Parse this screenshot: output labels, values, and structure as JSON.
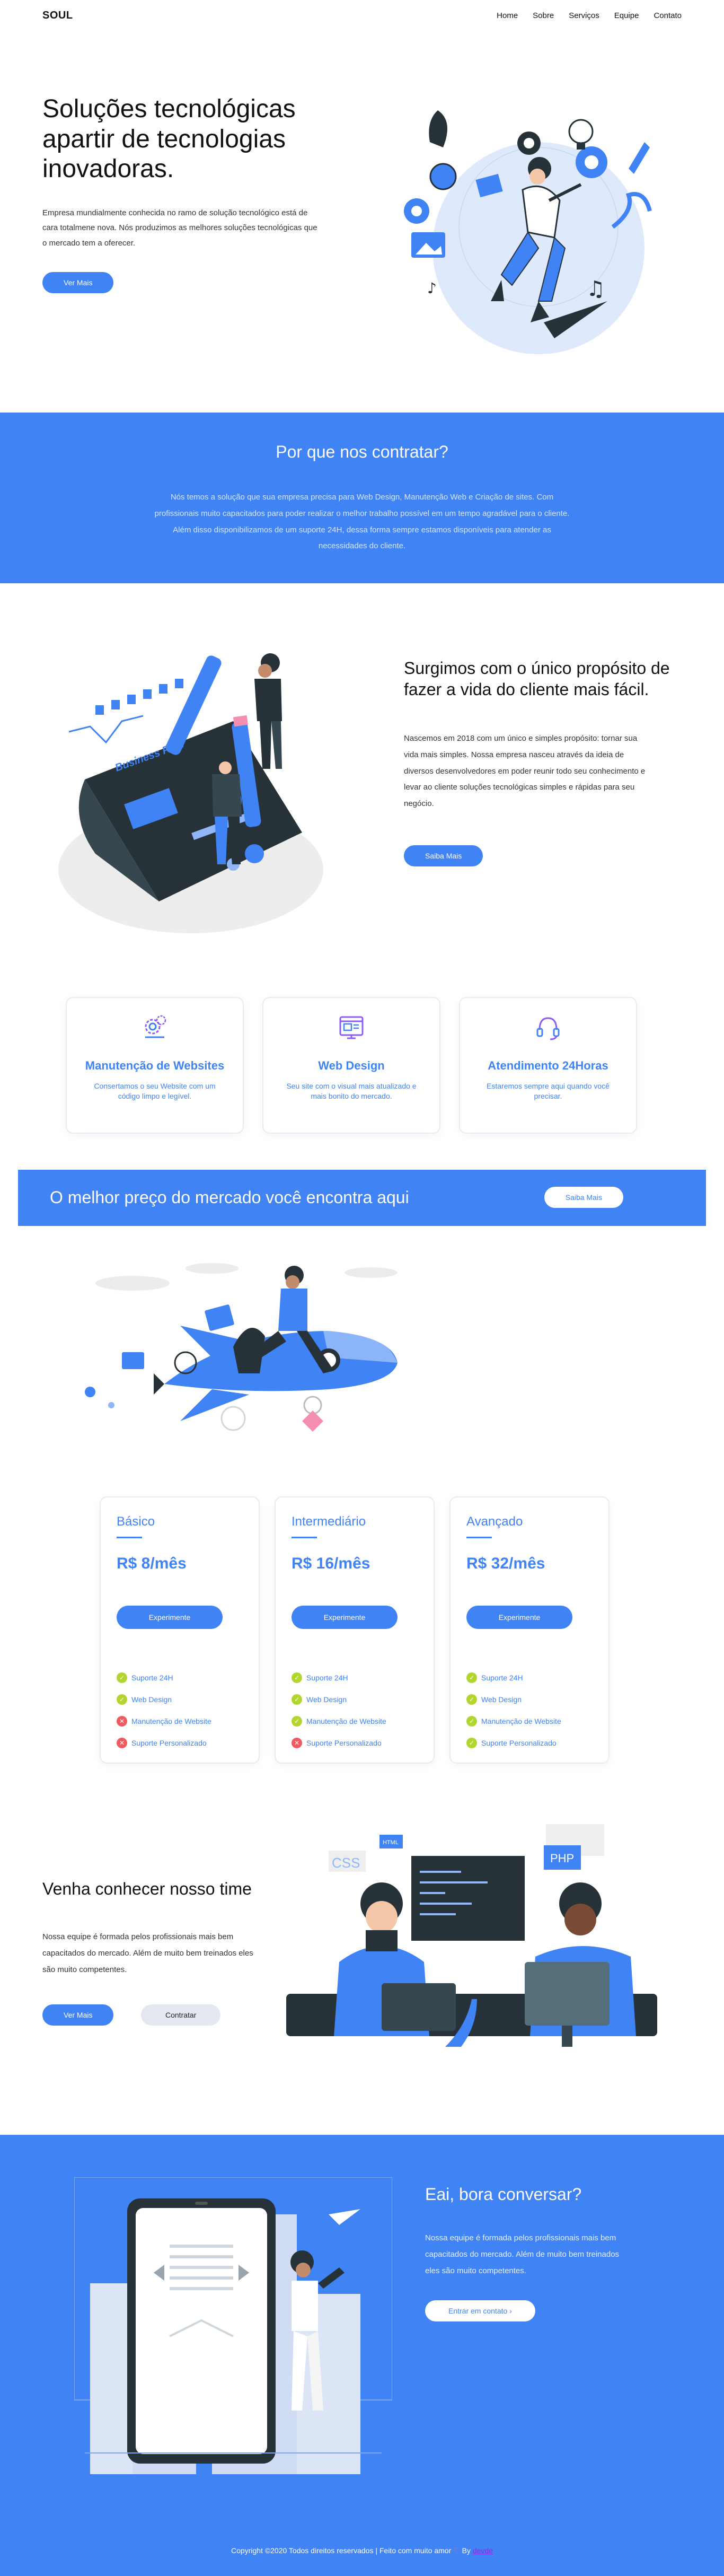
{
  "nav": {
    "brand": "SOUL",
    "items": [
      "Home",
      "Sobre",
      "Serviços",
      "Equipe",
      "Contato"
    ]
  },
  "hero": {
    "title": "Soluções tecnológicas apartir de tecnologias inovadoras.",
    "description": "Empresa mundialmente conhecida no ramo de solução tecnológico está de cara totalmene nova. Nós produzimos as melhores soluções tecnológicas que o mercado tem a oferecer.",
    "button": "Ver Mais"
  },
  "why": {
    "title": "Por que nos contratar?",
    "text": "Nós temos a solução que sua empresa precisa para Web Design, Manutenção Web e Criação de sites. Com profissionais muito capacitados para poder realizar o melhor trabalho possível em um tempo agradável para o cliente. Além disso disponibilizamos de um suporte 24H, dessa forma sempre estamos disponíveis para atender as necessidades do cliente."
  },
  "about": {
    "title": "Surgimos com o único propósito de fazer a vida do cliente mais fácil.",
    "text": "Nascemos em 2018 com um único e simples propósito: tornar sua vida mais simples. Nossa empresa nasceu através da ideia de diversos desenvolvedores em poder reunir todo seu conhecimento e levar ao cliente soluções tecnológicas simples e rápidas para seu negócio.",
    "button": "Saiba Mais",
    "illustration_board_text": "Business Plan"
  },
  "services": [
    {
      "title": "Manutenção de Websites",
      "text": "Consertamos o seu Website com um código limpo e legível.",
      "icon": "gears-icon"
    },
    {
      "title": "Web Design",
      "text": "Seu site com o visual mais atualizado e mais bonito do mercado.",
      "icon": "browser-design-icon"
    },
    {
      "title": "Atendimento 24Horas",
      "text": "Estaremos sempre aqui quando você precisar.",
      "icon": "headset-icon"
    }
  ],
  "banner": {
    "title": "O melhor preço do mercado você encontra aqui",
    "button": "Saiba Mais"
  },
  "pricing": {
    "plans": [
      {
        "name": "Básico",
        "price": "R$ 8/mês",
        "button": "Experimente",
        "features": [
          {
            "label": "Suporte 24H",
            "included": true
          },
          {
            "label": "Web Design",
            "included": true
          },
          {
            "label": "Manutenção de Website",
            "included": false
          },
          {
            "label": "Suporte Personalizado",
            "included": false
          }
        ]
      },
      {
        "name": "Intermediário",
        "price": "R$ 16/mês",
        "button": "Experimente",
        "features": [
          {
            "label": "Suporte 24H",
            "included": true
          },
          {
            "label": "Web Design",
            "included": true
          },
          {
            "label": "Manutenção de Website",
            "included": true
          },
          {
            "label": "Suporte Personalizado",
            "included": false
          }
        ]
      },
      {
        "name": "Avançado",
        "price": "R$ 32/mês",
        "button": "Experimente",
        "features": [
          {
            "label": "Suporte 24H",
            "included": true
          },
          {
            "label": "Web Design",
            "included": true
          },
          {
            "label": "Manutenção de Website",
            "included": true
          },
          {
            "label": "Suporte Personalizado",
            "included": true
          }
        ]
      }
    ]
  },
  "team": {
    "title": "Venha conhecer nosso time",
    "text": "Nossa equipe é formada pelos profissionais mais bem capacitados do mercado. Além de muito bem treinados eles são muito competentes.",
    "button_primary": "Ver Mais",
    "button_secondary": "Contratar",
    "illustration_tags": [
      "CSS",
      "HTML",
      "PHP"
    ]
  },
  "contact": {
    "title": "Eai, bora conversar?",
    "text": "Nossa equipe é formada pelos profissionais mais bem capacitados do mercado. Além de muito bem treinados eles são muito competentes.",
    "button": "Entrar em contato ›"
  },
  "footer": {
    "text_before": "Copyright ©2020 Todos direitos reservados | Feito com muito amor",
    "heart": "♡",
    "by": "By",
    "author": "devde"
  },
  "colors": {
    "accent": "#3f83f5",
    "check": "#b3d52f",
    "cross": "#f05a60",
    "text": "#111111"
  }
}
